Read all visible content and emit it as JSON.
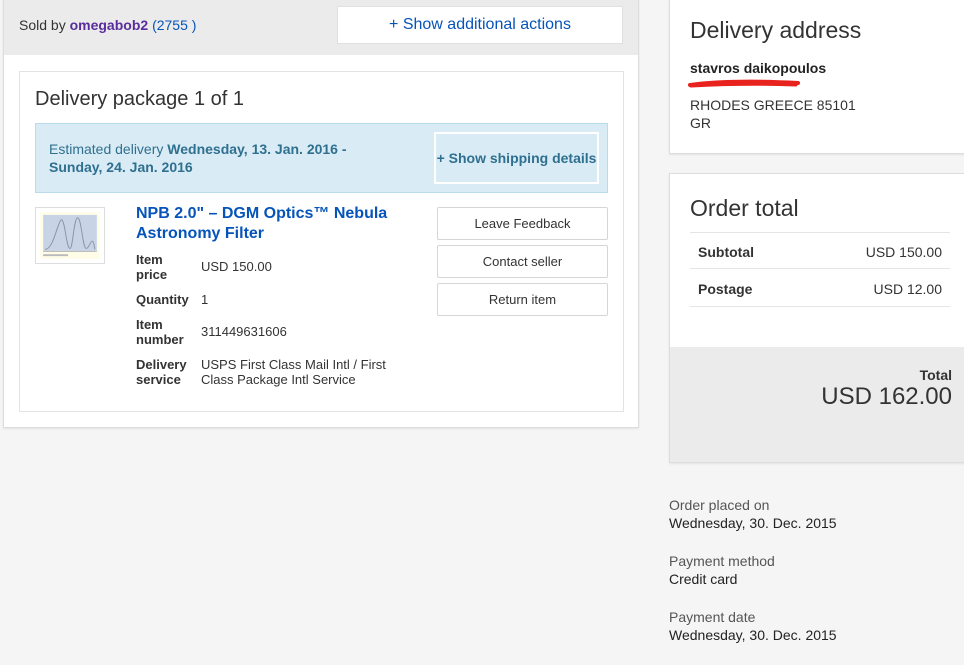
{
  "seller": {
    "prefix": "Sold by",
    "name": "omegabob2",
    "score_open": "(",
    "score": "2755",
    "score_close": ")"
  },
  "actions": {
    "show_additional": "+ Show additional actions"
  },
  "package": {
    "title": "Delivery package 1 of 1",
    "estimated_prefix": "Estimated delivery",
    "estimated_range": "Wednesday, 13. Jan. 2016 - Sunday, 24. Jan. 2016",
    "show_shipping": "+ Show shipping details"
  },
  "item": {
    "title": "NPB 2.0\" – DGM Optics™ Nebula Astronomy Filter",
    "price_label": "Item price",
    "price": "USD 150.00",
    "quantity_label": "Quantity",
    "quantity": "1",
    "number_label": "Item number",
    "number": "311449631606",
    "delivery_label": "Delivery service",
    "delivery": "USPS First Class Mail Intl / First Class Package Intl Service"
  },
  "item_actions": {
    "leave_feedback": "Leave Feedback",
    "contact_seller": "Contact seller",
    "return_item": "Return item"
  },
  "address": {
    "title": "Delivery address",
    "name": "stavros daikopoulos",
    "city_line": "RHODES GREECE 85101",
    "country": "GR"
  },
  "order_total": {
    "title": "Order total",
    "subtotal_label": "Subtotal",
    "subtotal": "USD 150.00",
    "postage_label": "Postage",
    "postage": "USD 12.00",
    "total_label": "Total",
    "total": "USD 162.00"
  },
  "order_info": {
    "placed_label": "Order placed on",
    "placed_value": "Wednesday, 30. Dec. 2015",
    "payment_method_label": "Payment method",
    "payment_method_value": "Credit card",
    "payment_date_label": "Payment date",
    "payment_date_value": "Wednesday, 30. Dec. 2015"
  },
  "colors": {
    "link": "#0654ba",
    "seller_name": "#5a2d9c",
    "info_bg": "#d9ecf5",
    "redaction": "#e8231e"
  }
}
